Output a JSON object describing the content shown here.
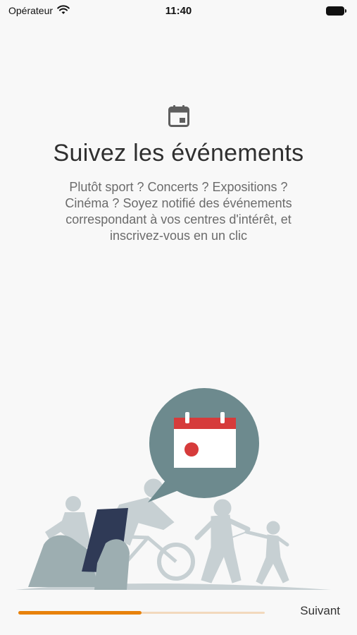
{
  "status_bar": {
    "carrier": "Opérateur",
    "time": "11:40"
  },
  "onboarding": {
    "icon": "calendar-icon",
    "title": "Suivez les événements",
    "description_lines": [
      "Plutôt sport ? Concerts ? Expositions ?",
      "Cinéma ? Soyez notifié des événements",
      "correspondant à vos centres d'intérêt, et",
      "inscrivez-vous en un clic"
    ]
  },
  "progress": {
    "fraction": 0.5
  },
  "footer": {
    "next_label": "Suivant"
  },
  "colors": {
    "accent": "#e8820c",
    "bubble": "#6d8a8e",
    "calendar_red": "#d63b3b",
    "silhouettes": "#c7d0d3"
  }
}
